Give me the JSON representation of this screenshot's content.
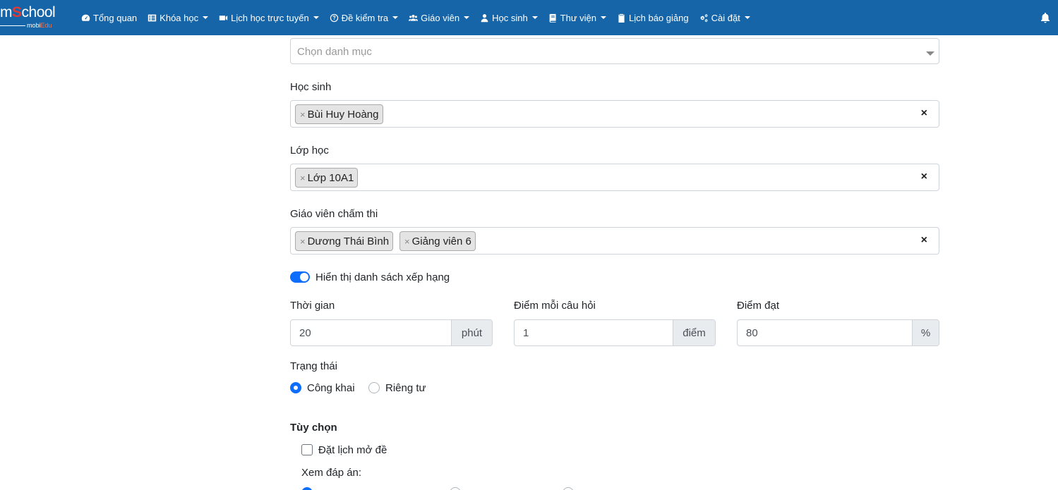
{
  "brand": {
    "name_prefix": "m",
    "name_s": "S",
    "name_suffix": "chool",
    "sub_prefix": "mobi",
    "sub_suffix": "Edu"
  },
  "nav": {
    "items": [
      {
        "label": "Tổng quan",
        "icon": "dashboard-icon",
        "dropdown": false
      },
      {
        "label": "Khóa học",
        "icon": "list-icon",
        "dropdown": true
      },
      {
        "label": "Lịch học trực tuyến",
        "icon": "video-icon",
        "dropdown": true
      },
      {
        "label": "Đề kiểm tra",
        "icon": "question-circle-icon",
        "dropdown": true
      },
      {
        "label": "Giáo viên",
        "icon": "users-icon",
        "dropdown": true
      },
      {
        "label": "Học sinh",
        "icon": "user-icon",
        "dropdown": true
      },
      {
        "label": "Thư viện",
        "icon": "book-icon",
        "dropdown": true
      },
      {
        "label": "Lịch báo giảng",
        "icon": "clipboard-icon",
        "dropdown": false
      },
      {
        "label": "Cài đặt",
        "icon": "cogs-icon",
        "dropdown": true
      }
    ],
    "notification_icon": "bell-icon"
  },
  "form": {
    "category": {
      "placeholder": "Chọn danh mục"
    },
    "students": {
      "label": "Học sinh",
      "tags": [
        "Bùi Huy Hoàng"
      ],
      "clear": "×"
    },
    "classes": {
      "label": "Lớp học",
      "tags": [
        "Lớp 10A1"
      ],
      "clear": "×"
    },
    "graders": {
      "label": "Giáo viên chấm thi",
      "tags": [
        "Dương Thái Bình",
        "Giảng viên 6"
      ],
      "clear": "×"
    },
    "tag_remove": "×",
    "show_ranking": {
      "label": "Hiển thị danh sách xếp hạng",
      "enabled": true
    },
    "time": {
      "label": "Thời gian",
      "value": "20",
      "unit": "phút"
    },
    "points_per_question": {
      "label": "Điểm mỗi câu hỏi",
      "value": "1",
      "unit": "điểm"
    },
    "pass_score": {
      "label": "Điểm đạt",
      "value": "80",
      "unit": "%"
    },
    "status": {
      "label": "Trạng thái",
      "options": [
        "Công khai",
        "Riêng tư"
      ],
      "selected": "Công khai"
    },
    "options": {
      "label": "Tùy chọn",
      "schedule_open": {
        "label": "Đặt lịch mở đề",
        "checked": false
      },
      "view_answers": {
        "label": "Xem đáp án:"
      }
    }
  }
}
